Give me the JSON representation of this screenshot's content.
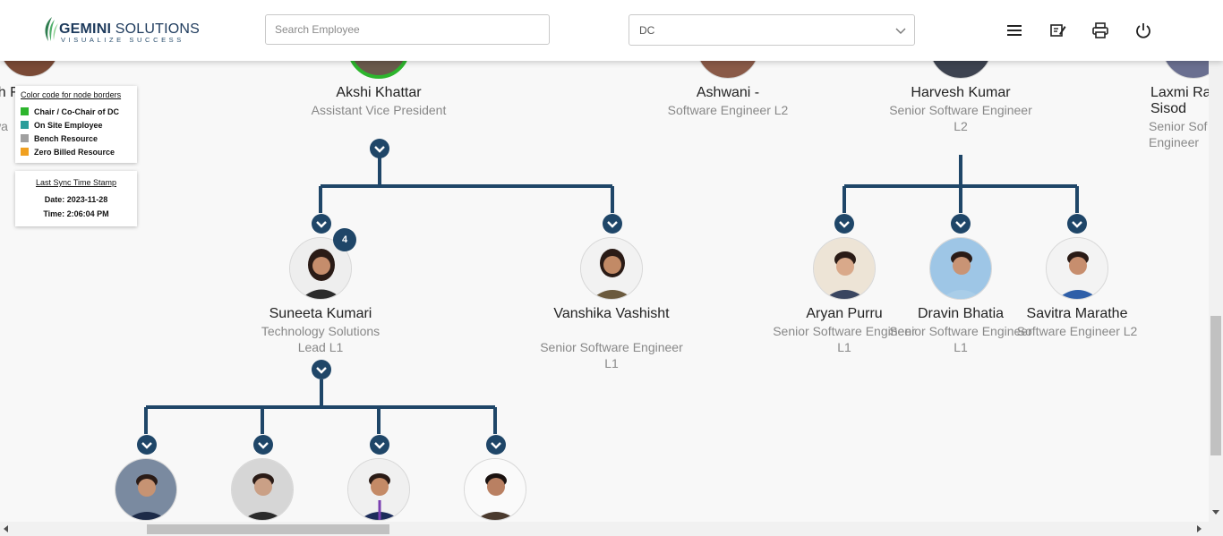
{
  "header": {
    "logo_text_bold": "GEMINI",
    "logo_text": " SOLUTIONS",
    "logo_tagline": "VISUALIZE SUCCESS",
    "search_placeholder": "Search Employee",
    "select_value": "DC",
    "icons": [
      "menu-icon",
      "edit-note-icon",
      "print-icon",
      "power-icon"
    ]
  },
  "legend": {
    "title": "Color code for node borders",
    "items": [
      {
        "label": "Chair / Co-Chair of DC",
        "color": "#2db52d"
      },
      {
        "label": "On Site Employee",
        "color": "#2a9d9a"
      },
      {
        "label": "Bench Resource",
        "color": "#a0a0a0"
      },
      {
        "label": "Zero Billed Resource",
        "color": "#f0a020"
      }
    ]
  },
  "sync": {
    "title": "Last Sync Time Stamp",
    "date": "Date: 2023-11-28",
    "time": "Time: 2:06:04 PM"
  },
  "top_row": [
    {
      "name": "Akshi Khattar",
      "title": "Assistant Vice President",
      "border": "#2db52d"
    },
    {
      "name": "Ashwani -",
      "title": "Software Engineer L2"
    },
    {
      "name": "Harvesh Kumar",
      "title": "Senior Software Engineer L2"
    },
    {
      "name": "Laxmi Ra Sisod",
      "title": "Senior Sof Engineer"
    }
  ],
  "left_partial": {
    "name": "Akh F",
    "title": "wa"
  },
  "second_row": [
    {
      "name": "Suneeta Kumari",
      "title": "Technology Solutions Lead L1",
      "badge": "4"
    },
    {
      "name": "Vanshika Vashisht",
      "title": "Senior Software Engineer L1"
    },
    {
      "name": "Aryan Purru",
      "title": "Senior Software Engineer L1"
    },
    {
      "name": "Dravin Bhatia",
      "title": "Senior Software Engineer L1"
    },
    {
      "name": "Savitra Marathe",
      "title": "Software Engineer L2"
    }
  ],
  "colors": {
    "line": "#1f4668",
    "accent": "#1f4668",
    "chair": "#2db52d"
  }
}
